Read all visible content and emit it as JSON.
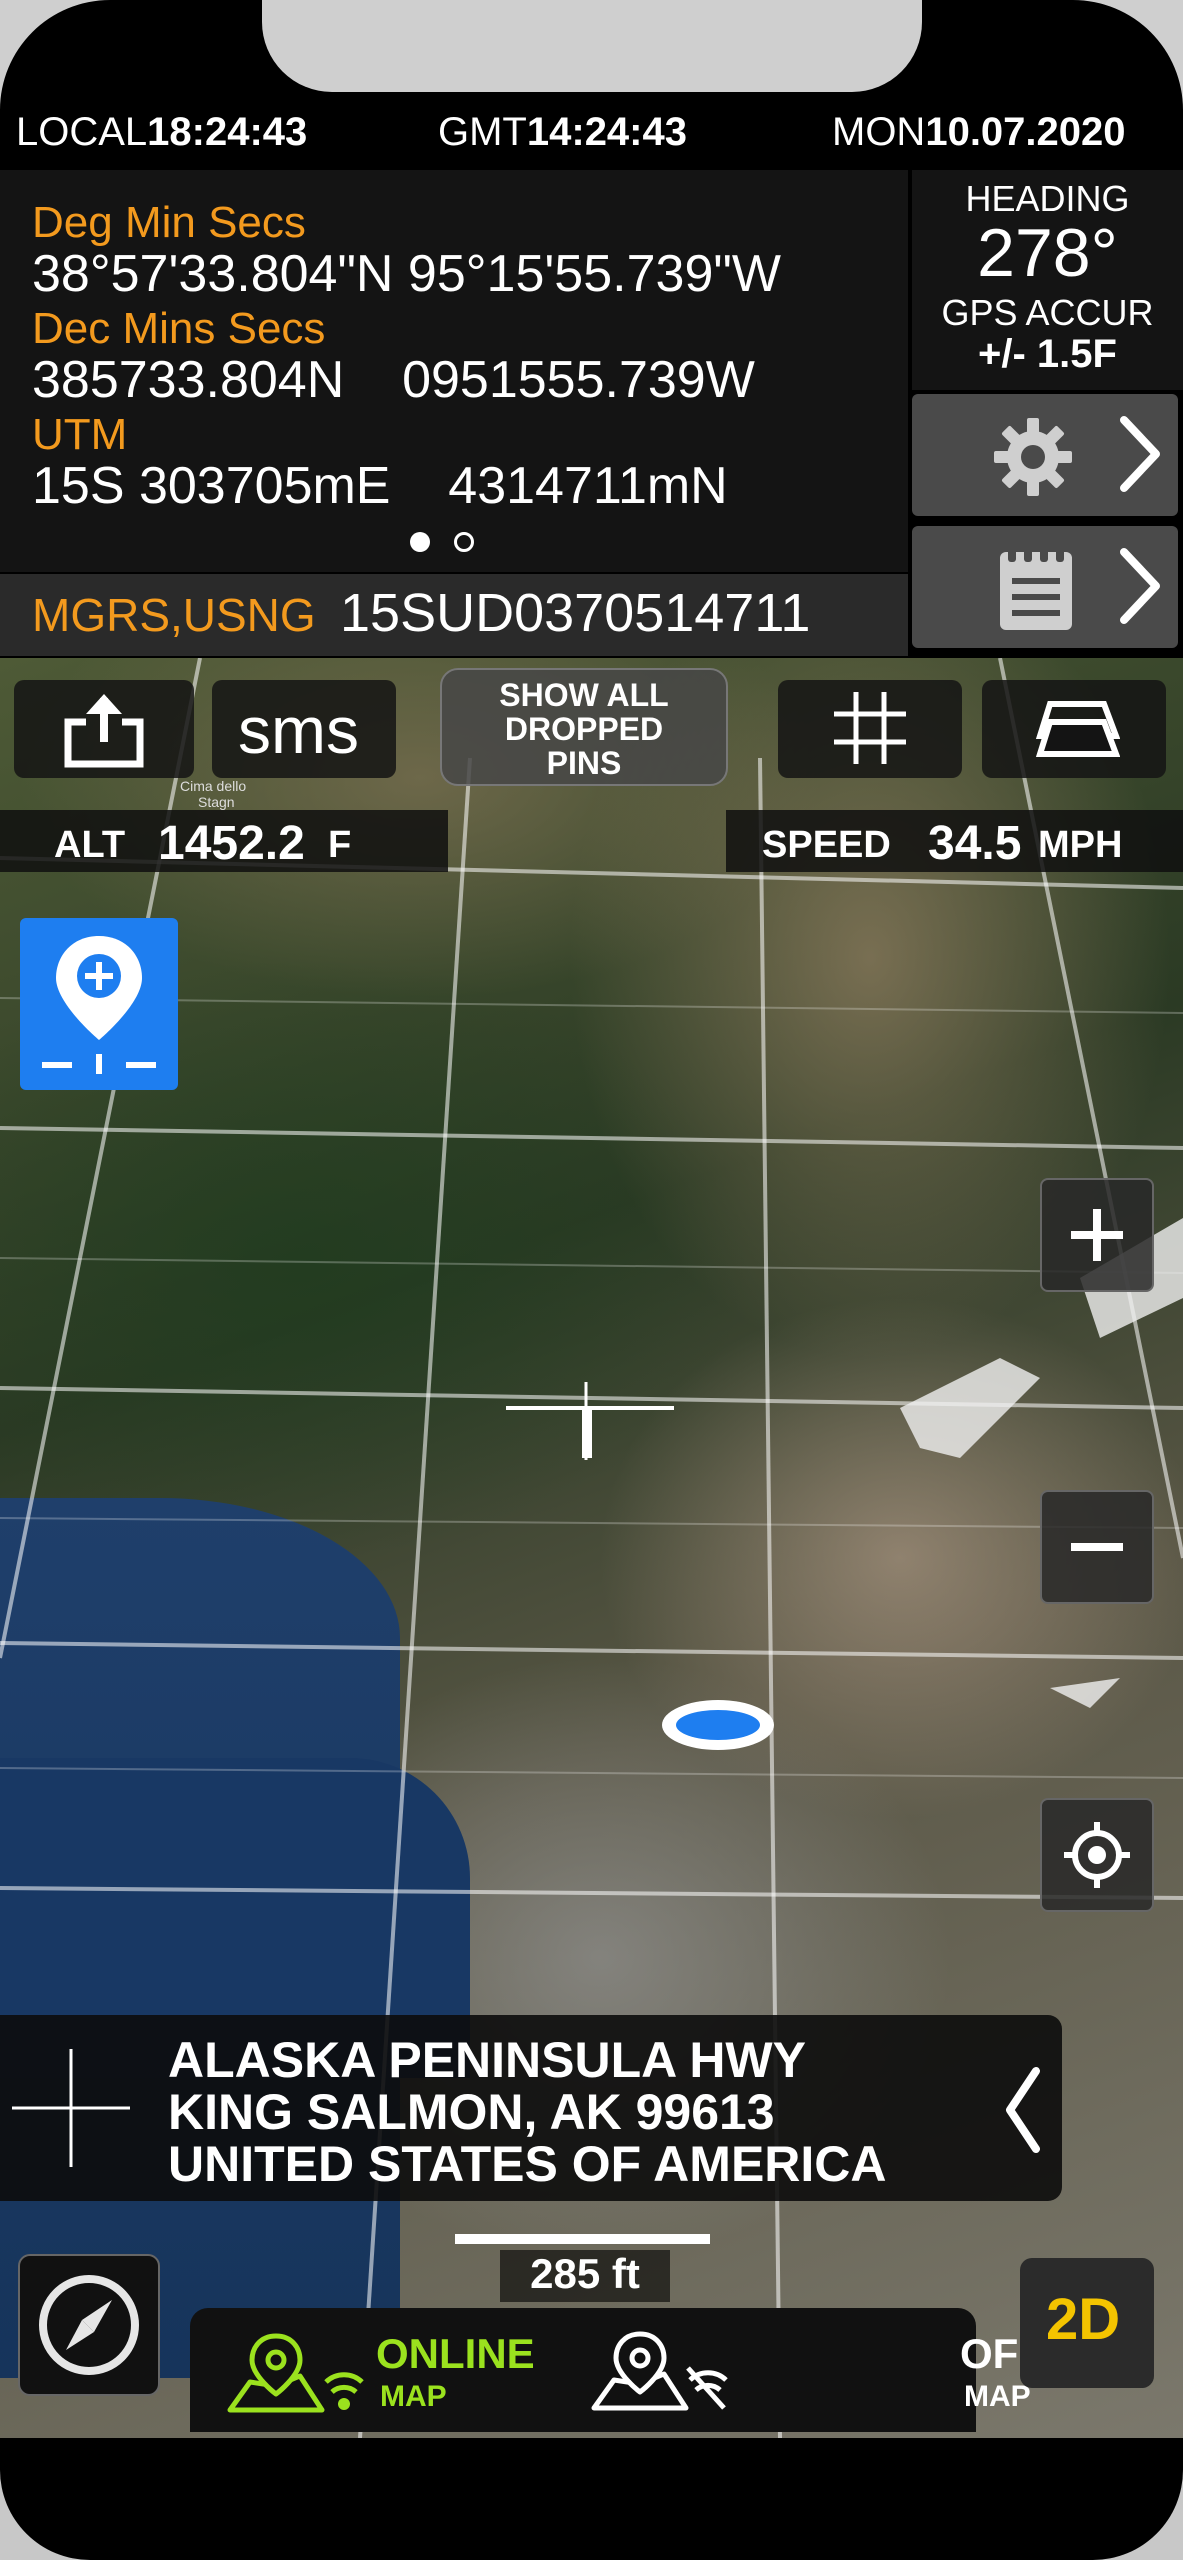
{
  "status_bar": {
    "local_label": "LOCAL",
    "local_time": "18:24:43",
    "gmt_label": "GMT",
    "gmt_time": "14:24:43",
    "day": "MON",
    "date": "10.07.2020"
  },
  "coordinates": {
    "dms_label": "Deg Min Secs",
    "dms_value": "38°57'33.804\"N 95°15'55.739\"W",
    "dec_label": "Dec Mins Secs",
    "dec_value": "385733.804N    0951555.739W",
    "utm_label": "UTM",
    "utm_value": "15S 303705mE    4314711mN",
    "page_index": 0,
    "page_count": 2
  },
  "mgrs": {
    "label": "MGRS,USNG",
    "value": "15SUD0370514711"
  },
  "heading": {
    "label": "HEADING",
    "value": "278°",
    "accuracy_label": "GPS ACCUR",
    "accuracy_value": "+/- 1.5F"
  },
  "side_buttons": [
    {
      "icon": "gear-icon"
    },
    {
      "icon": "notepad-icon"
    }
  ],
  "toolbar": {
    "share_icon": "share-icon",
    "sms_label": "sms",
    "show_pins_label_1": "SHOW ALL",
    "show_pins_label_2": "DROPPED",
    "show_pins_label_3": "PINS",
    "grid_icon": "grid-icon",
    "layers_icon": "layers-icon"
  },
  "readouts": {
    "alt_label": "ALT",
    "alt_value": "1452.2",
    "alt_unit": "F",
    "speed_label": "SPEED",
    "speed_value": "34.5",
    "speed_unit": "MPH"
  },
  "map_labels": {
    "place_1": "Cima dello",
    "place_2": "Stagn"
  },
  "address": {
    "line1": "ALASKA PENINSULA HWY",
    "line2": "KING SALMON, AK 99613",
    "line3": "UNITED STATES OF AMERICA"
  },
  "scale": {
    "label": "285 ft"
  },
  "map_mode": {
    "online_label": "ONLINE",
    "online_sub": "MAP",
    "offline_label": "OFFLINE",
    "offline_sub": "MAP",
    "view_label": "2D"
  },
  "colors": {
    "accent_orange": "#f39a1e",
    "online_green": "#9be21e",
    "view_yellow": "#f4c400",
    "pin_blue": "#1e7ef0"
  }
}
